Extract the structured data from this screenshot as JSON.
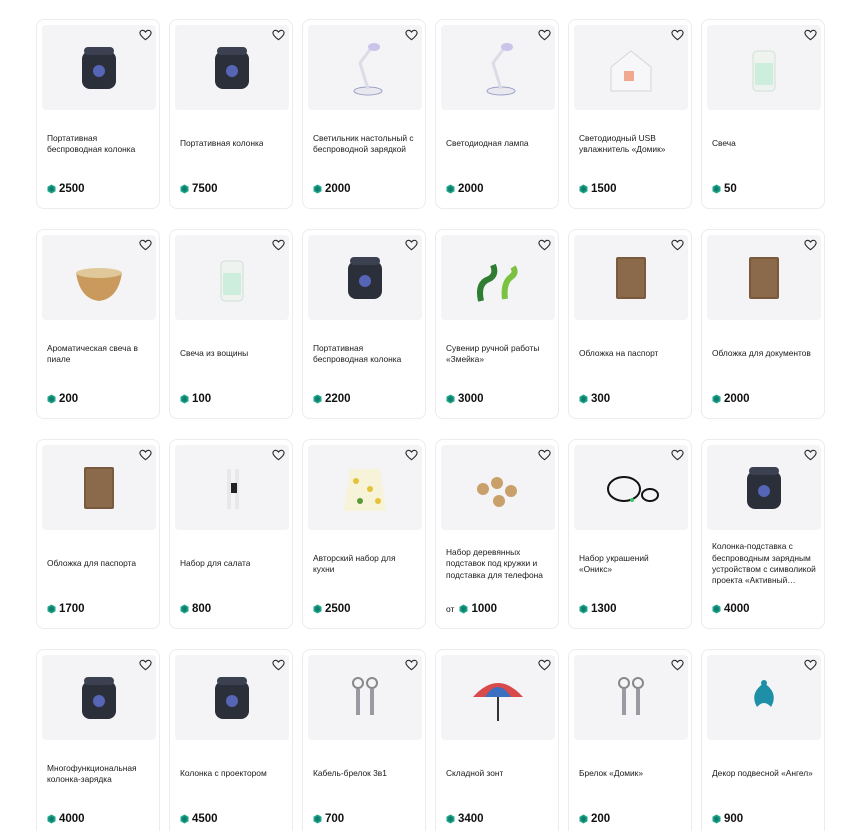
{
  "products": [
    {
      "title": "Портативная беспроводная колонка",
      "price": "2500",
      "from": "",
      "image": "speaker-icon"
    },
    {
      "title": "Портативная колонка",
      "price": "7500",
      "from": "",
      "image": "speaker-icon"
    },
    {
      "title": "Светильник настольный с беспроводной зарядкой",
      "price": "2000",
      "from": "",
      "image": "lamp-icon"
    },
    {
      "title": "Светодиодная лампа",
      "price": "2000",
      "from": "",
      "image": "lamp-icon"
    },
    {
      "title": "Светодиодный USB увлажнитель «Домик»",
      "price": "1500",
      "from": "",
      "image": "house-icon"
    },
    {
      "title": "Свеча",
      "price": "50",
      "from": "",
      "image": "candle-icon"
    },
    {
      "title": "Ароматическая свеча в пиале",
      "price": "200",
      "from": "",
      "image": "bowl-icon"
    },
    {
      "title": "Свеча из вощины",
      "price": "100",
      "from": "",
      "image": "candle-icon"
    },
    {
      "title": "Портативная беспроводная колонка",
      "price": "2200",
      "from": "",
      "image": "speaker-icon"
    },
    {
      "title": "Сувенир ручной работы «Змейка»",
      "price": "3000",
      "from": "",
      "image": "snake-icon"
    },
    {
      "title": "Обложка на паспорт",
      "price": "300",
      "from": "",
      "image": "cover-icon"
    },
    {
      "title": "Обложка для документов",
      "price": "2000",
      "from": "",
      "image": "cover-icon"
    },
    {
      "title": "Обложка для паспорта",
      "price": "1700",
      "from": "",
      "image": "cover-icon"
    },
    {
      "title": "Набор для салата",
      "price": "800",
      "from": "",
      "image": "utensils-icon"
    },
    {
      "title": "Авторский набор для кухни",
      "price": "2500",
      "from": "",
      "image": "apron-icon"
    },
    {
      "title": "Набор деревянных подставок под кружки и подставка для телефона",
      "price": "1000",
      "from": "от",
      "image": "coaster-icon"
    },
    {
      "title": "Набор украшений «Оникс»",
      "price": "1300",
      "from": "",
      "image": "bracelet-icon"
    },
    {
      "title": "Колонка-подставка с беспроводным зарядным устройством с символикой проекта «Активный…",
      "price": "4000",
      "from": "",
      "image": "speaker-icon"
    },
    {
      "title": "Многофункциональная колонка-зарядка",
      "price": "4000",
      "from": "",
      "image": "speaker-icon"
    },
    {
      "title": "Колонка с проектором",
      "price": "4500",
      "from": "",
      "image": "speaker-icon"
    },
    {
      "title": "Кабель-брелок 3в1",
      "price": "700",
      "from": "",
      "image": "keychain-icon"
    },
    {
      "title": "Складной зонт",
      "price": "3400",
      "from": "",
      "image": "umbrella-icon"
    },
    {
      "title": "Брелок «Домик»",
      "price": "200",
      "from": "",
      "image": "keychain-icon"
    },
    {
      "title": "Декор подвесной «Ангел»",
      "price": "900",
      "from": "",
      "image": "angel-icon"
    }
  ],
  "colors": {
    "coin": "#1aa38a",
    "card_border": "#ececef",
    "image_bg": "#f4f4f6"
  }
}
